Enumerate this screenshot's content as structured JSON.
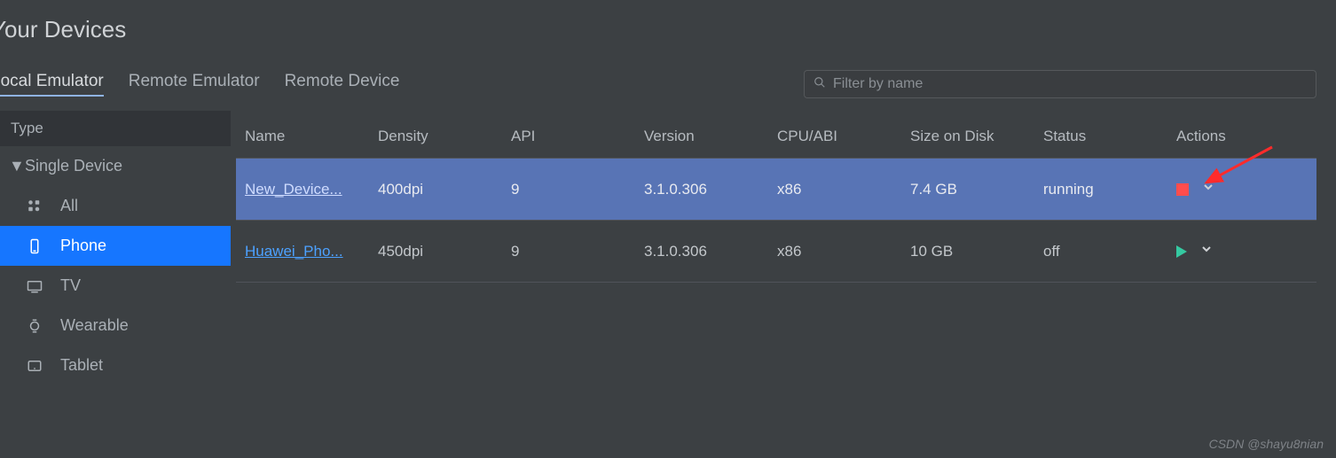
{
  "title": "Your Devices",
  "tabs": [
    {
      "label": "Local Emulator",
      "active": true
    },
    {
      "label": "Remote Emulator",
      "active": false
    },
    {
      "label": "Remote Device",
      "active": false
    }
  ],
  "search": {
    "placeholder": "Filter by name"
  },
  "sidebar": {
    "header": "Type",
    "group_label": "Single Device",
    "items": [
      {
        "label": "All",
        "icon": "grid-icon"
      },
      {
        "label": "Phone",
        "icon": "phone-icon",
        "selected": true
      },
      {
        "label": "TV",
        "icon": "tv-icon"
      },
      {
        "label": "Wearable",
        "icon": "watch-icon"
      },
      {
        "label": "Tablet",
        "icon": "tablet-icon"
      }
    ]
  },
  "table": {
    "columns": [
      "Name",
      "Density",
      "API",
      "Version",
      "CPU/ABI",
      "Size on Disk",
      "Status",
      "Actions"
    ],
    "rows": [
      {
        "name": "New_Device...",
        "density": "400dpi",
        "api": "9",
        "version": "3.1.0.306",
        "cpu": "x86",
        "size": "7.4 GB",
        "status": "running",
        "selected": true,
        "action": "stop"
      },
      {
        "name": "Huawei_Pho...",
        "density": "450dpi",
        "api": "9",
        "version": "3.1.0.306",
        "cpu": "x86",
        "size": "10 GB",
        "status": "off",
        "selected": false,
        "action": "play"
      }
    ]
  },
  "watermark": "CSDN @shayu8nian"
}
